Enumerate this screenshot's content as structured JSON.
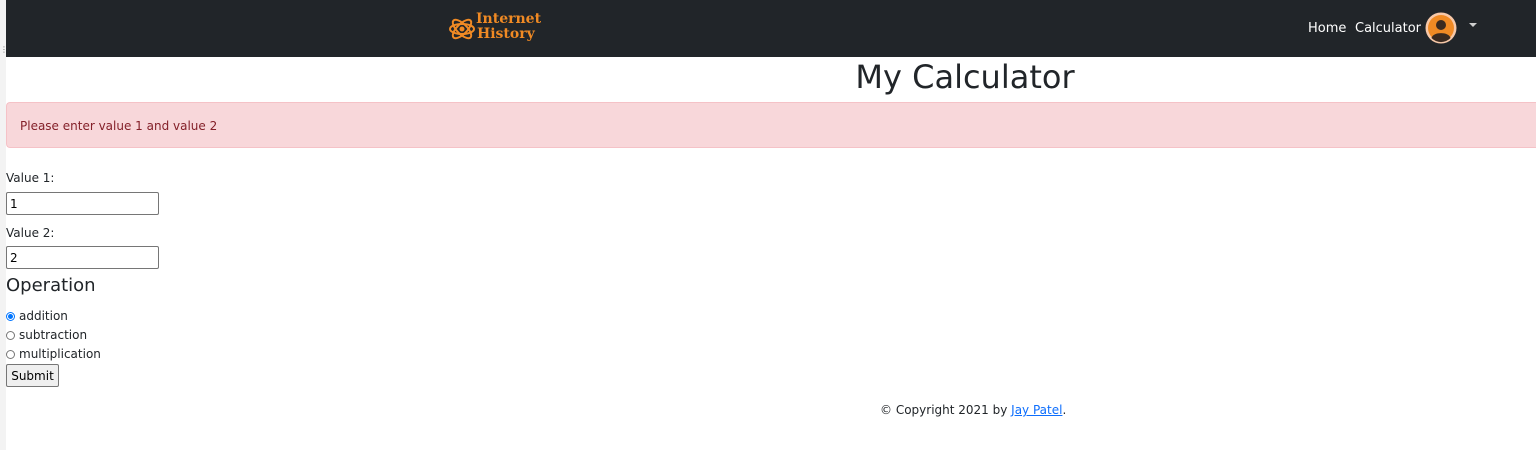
{
  "navbar": {
    "brand_line1": "Internet",
    "brand_line2": "History",
    "links": [
      "Home",
      "Calculator"
    ],
    "bg_color": "#212529",
    "brand_color": "#f08a24"
  },
  "page": {
    "title": "My Calculator"
  },
  "alert": {
    "message": "Please enter value 1 and value 2",
    "bg_color": "#f8d7da",
    "text_color": "#842029"
  },
  "form": {
    "value1_label": "Value 1:",
    "value1": "1",
    "value2_label": "Value 2:",
    "value2": "2",
    "operation_heading": "Operation",
    "operations": [
      "addition",
      "subtraction",
      "multiplication"
    ],
    "selected_operation": "addition",
    "submit_label": "Submit"
  },
  "footer": {
    "prefix": "© Copyright 2021 by ",
    "author": "Jay Patel",
    "suffix": "."
  },
  "icons": {
    "brand": "atom-logo-icon",
    "avatar": "user-avatar-icon",
    "dropdown": "caret-down-icon",
    "radio_checked": "radio-checked-icon",
    "radio_unchecked": "radio-unchecked-icon"
  }
}
